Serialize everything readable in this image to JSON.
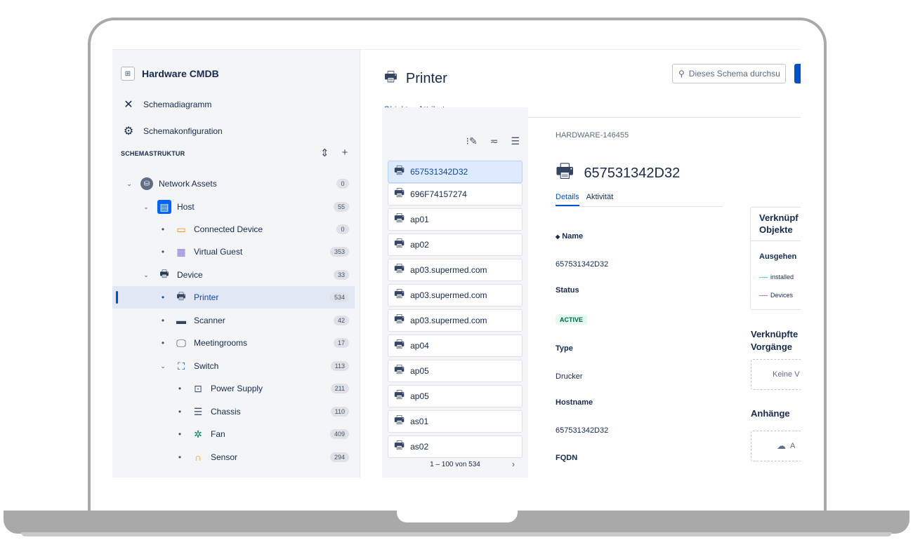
{
  "sidebar": {
    "schema_title": "Hardware CMDB",
    "links": [
      {
        "label": "Schemadiagramm",
        "icon": "diagram-icon"
      },
      {
        "label": "Schemakonfiguration",
        "icon": "gear-icon"
      }
    ],
    "section_label": "SCHEMASTRUKTUR",
    "tree": [
      {
        "label": "Network Assets",
        "count": "0",
        "icon": "database-icon",
        "level": 0,
        "toggle": "expanded"
      },
      {
        "label": "Host",
        "count": "55",
        "icon": "server-icon",
        "level": 1,
        "toggle": "expanded"
      },
      {
        "label": "Connected Device",
        "count": "0",
        "icon": "devices-icon",
        "level": 2,
        "toggle": "dot"
      },
      {
        "label": "Virtual Guest",
        "count": "353",
        "icon": "virtual-guest-icon",
        "level": 2,
        "toggle": "dot"
      },
      {
        "label": "Device",
        "count": "33",
        "icon": "device-icon",
        "level": 1,
        "toggle": "expanded"
      },
      {
        "label": "Printer",
        "count": "534",
        "icon": "printer-icon",
        "level": 2,
        "toggle": "dot",
        "selected": true
      },
      {
        "label": "Scanner",
        "count": "42",
        "icon": "scanner-icon",
        "level": 2,
        "toggle": "dot"
      },
      {
        "label": "Meetingrooms",
        "count": "17",
        "icon": "meetingroom-icon",
        "level": 2,
        "toggle": "dot"
      },
      {
        "label": "Switch",
        "count": "113",
        "icon": "switch-icon",
        "level": 2,
        "toggle": "expanded"
      },
      {
        "label": "Power Supply",
        "count": "211",
        "icon": "power-supply-icon",
        "level": 3,
        "toggle": "dot"
      },
      {
        "label": "Chassis",
        "count": "110",
        "icon": "chassis-icon",
        "level": 3,
        "toggle": "dot"
      },
      {
        "label": "Fan",
        "count": "409",
        "icon": "fan-icon",
        "level": 3,
        "toggle": "dot"
      },
      {
        "label": "Sensor",
        "count": "294",
        "icon": "sensor-icon",
        "level": 3,
        "toggle": "dot"
      }
    ]
  },
  "main": {
    "title": "Printer",
    "search_placeholder": "Dieses Schema durchsu",
    "tabs": [
      "Objekte",
      "Attribute"
    ],
    "objects": [
      "657531342D32",
      "696F74157274",
      "ap01",
      "ap02",
      "ap03.supermed.com",
      "ap03.supermed.com",
      "ap03.supermed.com",
      "ap04",
      "ap05",
      "ap05",
      "as01",
      "as02"
    ],
    "pager": "1 – 100 von 534"
  },
  "details": {
    "object_key": "HARDWARE-146455",
    "title": "657531342D32",
    "tabs": [
      "Details",
      "Aktivität"
    ],
    "fields": [
      {
        "label": "Name",
        "value": "657531342D32"
      },
      {
        "label": "Status",
        "value": "ACTIVE"
      },
      {
        "label": "Type",
        "value": "Drucker"
      },
      {
        "label": "Hostname",
        "value": "657531342D32"
      },
      {
        "label": "FQDN",
        "value": ""
      }
    ]
  },
  "right_panel": {
    "linked_objects_title": "Verknüpf\nObjekte",
    "outgoing_label": "Ausgehen",
    "legend": [
      {
        "label": "installed",
        "color": "#57d9a3"
      },
      {
        "label": "Devices",
        "color": "#c377e0"
      }
    ],
    "linked_issues_title": "Verknüpfte\nVorgänge",
    "linked_issues_empty": "Keine V",
    "attachments_title": "Anhänge",
    "attachments_action": "A"
  },
  "colors": {
    "accent": "#0052cc",
    "selected_bg": "#deebff",
    "status_green": "#006644"
  }
}
